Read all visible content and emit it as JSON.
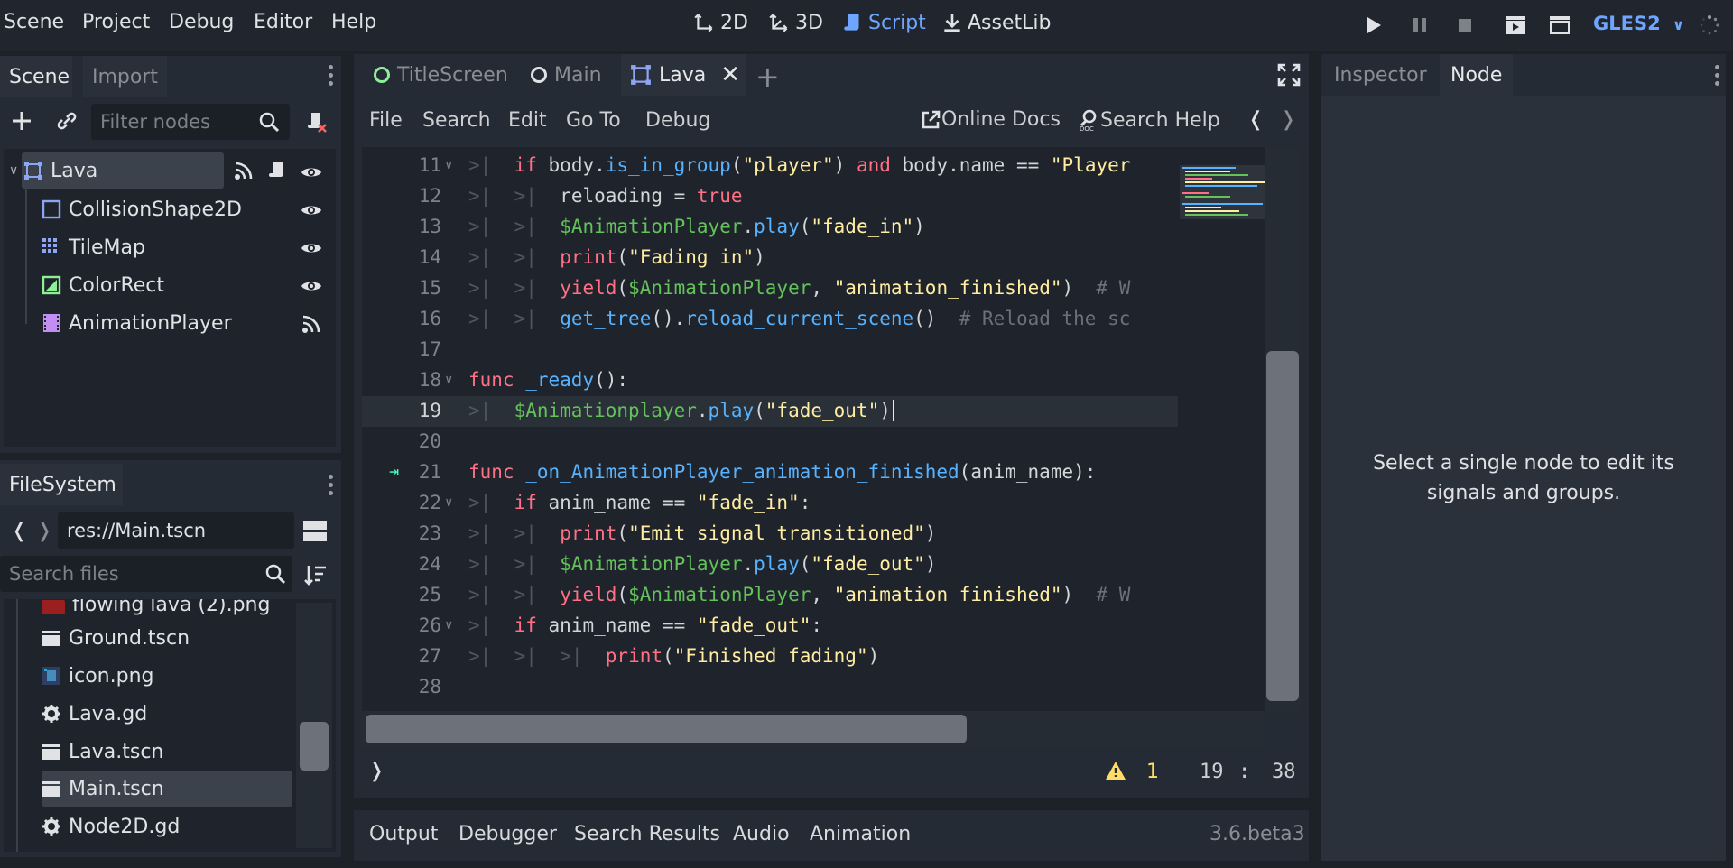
{
  "menu": [
    "Scene",
    "Project",
    "Debug",
    "Editor",
    "Help"
  ],
  "workspaces": {
    "w2d": "2D",
    "w3d": "3D",
    "script": "Script",
    "assetlib": "AssetLib"
  },
  "renderer": "GLES2",
  "scene_dock": {
    "tabs": [
      "Scene",
      "Import"
    ],
    "filter_placeholder": "Filter nodes",
    "nodes": [
      {
        "name": "Lava"
      },
      {
        "name": "CollisionShape2D"
      },
      {
        "name": "TileMap"
      },
      {
        "name": "ColorRect"
      },
      {
        "name": "AnimationPlayer"
      }
    ]
  },
  "filesystem": {
    "tab": "FileSystem",
    "path": "res://Main.tscn",
    "search_placeholder": "Search files",
    "files": [
      {
        "name": "flowing lava (2).png",
        "icon": "image-icon"
      },
      {
        "name": "Ground.tscn",
        "icon": "scene-icon"
      },
      {
        "name": "icon.png",
        "icon": "image-icon"
      },
      {
        "name": "Lava.gd",
        "icon": "gear-icon"
      },
      {
        "name": "Lava.tscn",
        "icon": "scene-icon"
      },
      {
        "name": "Main.tscn",
        "icon": "scene-icon"
      },
      {
        "name": "Node2D.gd",
        "icon": "gear-icon"
      }
    ]
  },
  "editor_tabs": [
    "TitleScreen",
    "Main",
    "Lava"
  ],
  "script_menu": [
    "File",
    "Search",
    "Edit",
    "Go To",
    "Debug"
  ],
  "online_docs": "Online Docs",
  "search_help": "Search Help",
  "code_lines": [
    {
      "n": "11",
      "fold": true,
      "indent": 1
    },
    {
      "n": "12",
      "indent": 2
    },
    {
      "n": "13",
      "indent": 2
    },
    {
      "n": "14",
      "indent": 2
    },
    {
      "n": "15",
      "indent": 2
    },
    {
      "n": "16",
      "indent": 2
    },
    {
      "n": "17",
      "indent": 0
    },
    {
      "n": "18",
      "fold": true,
      "indent": 0
    },
    {
      "n": "19",
      "indent": 1
    },
    {
      "n": "20",
      "indent": 0
    },
    {
      "n": "21",
      "indent": 0
    },
    {
      "n": "22",
      "fold": true,
      "indent": 1
    },
    {
      "n": "23",
      "indent": 2
    },
    {
      "n": "24",
      "indent": 2
    },
    {
      "n": "25",
      "indent": 2
    },
    {
      "n": "26",
      "fold": true,
      "indent": 1
    },
    {
      "n": "27",
      "indent": 3
    },
    {
      "n": "28",
      "indent": 0
    }
  ],
  "status": {
    "warnings": "1",
    "line": "19",
    "sep": ":",
    "col": "38"
  },
  "inspector": {
    "tabs": [
      "Inspector",
      "Node"
    ],
    "message": "Select a single node to edit its signals and groups."
  },
  "bottom_panel": [
    "Output",
    "Debugger",
    "Search Results",
    "Audio",
    "Animation"
  ],
  "version": "3.6.beta3"
}
